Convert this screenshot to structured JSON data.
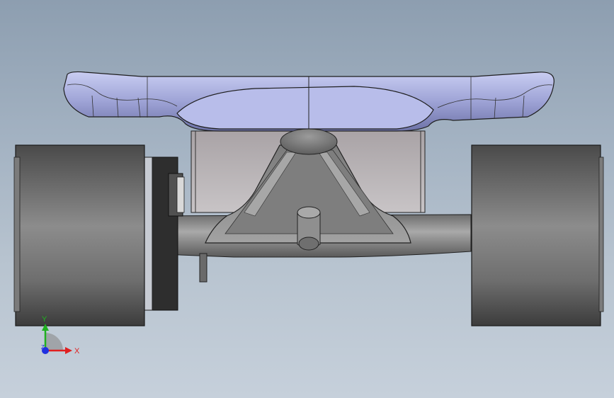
{
  "view": {
    "background_top": "#8d9eb0",
    "background_bottom": "#c6d0db"
  },
  "model": {
    "parts": [
      "deck",
      "left-wheel",
      "right-wheel",
      "truck-hanger",
      "axle",
      "motor-mount",
      "pivot-cup",
      "kingpin",
      "left-bearing",
      "left-brake-tab"
    ],
    "colors": {
      "deck": "#9a9fd3",
      "metal": "#8a8a8a",
      "wheel": "#5a5a5a",
      "mount_plate": "#b8b4b6"
    }
  },
  "triad": {
    "x_label": "X",
    "y_label": "Y",
    "z_label": "Z",
    "x_color": "#e02020",
    "y_color": "#20b020",
    "z_color": "#2030e0"
  }
}
